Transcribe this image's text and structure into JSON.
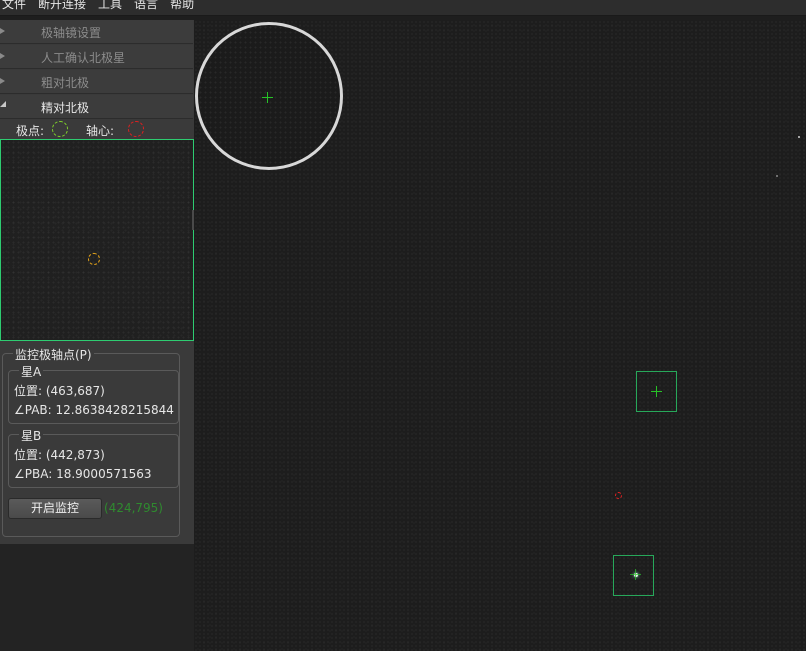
{
  "menu": {
    "items": [
      "文件",
      "断开连接",
      "工具",
      "语言",
      "帮助"
    ]
  },
  "sidebar": {
    "sections": [
      {
        "label": "极轴镜设置",
        "expanded": false
      },
      {
        "label": "人工确认北极星",
        "expanded": false
      },
      {
        "label": "粗对北极",
        "expanded": false
      },
      {
        "label": "精对北极",
        "expanded": true
      }
    ],
    "legend": {
      "pole_label": "极点:",
      "pole_color": "#7fd12a",
      "axis_label": "轴心:",
      "axis_color": "#e02020"
    },
    "target_marker_color": "#e3a21a",
    "monitor_group": {
      "title": "监控极轴点(P)",
      "star_a": {
        "title": "星A",
        "position": "位置: (463,687)",
        "angle": "∠PAB: 12.8638428215844"
      },
      "star_b": {
        "title": "星B",
        "position": "位置: (442,873)",
        "angle": "∠PBA: 18.9000571563"
      }
    },
    "start_button": "开启监控",
    "coordinate_readout": "(424,795)"
  },
  "view": {
    "accent_color": "#27a85a",
    "crosshair_color": "#27c227",
    "axis_marker_color": "#e02020"
  }
}
